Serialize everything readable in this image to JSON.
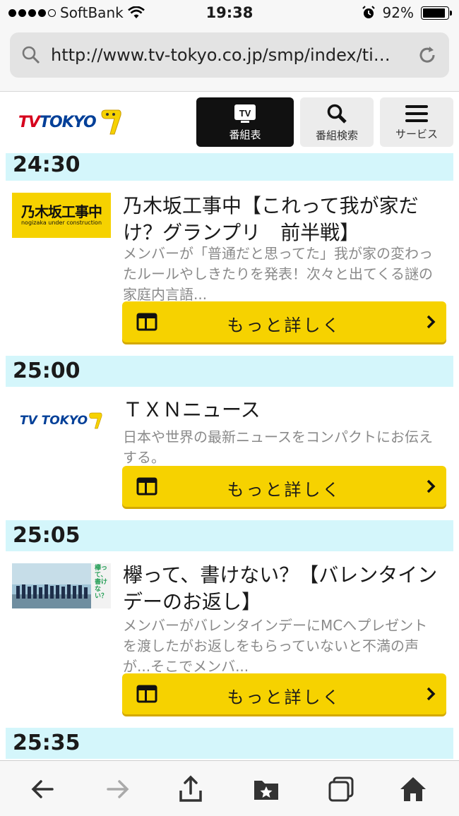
{
  "status_bar": {
    "carrier": "SoftBank",
    "time": "19:38",
    "battery": "92%",
    "battery_level": 0.92
  },
  "browser": {
    "url": "http://www.tv-tokyo.co.jp/smp/index/tim…"
  },
  "site_header": {
    "logo_tv": "TV",
    "logo_tokyo": "TOKYO",
    "nav": [
      {
        "label": "番組表",
        "icon": "tv-icon",
        "active": true
      },
      {
        "label": "番組検索",
        "icon": "search-icon",
        "active": false
      },
      {
        "label": "サービス",
        "icon": "menu-icon",
        "active": false
      }
    ]
  },
  "schedule": [
    {
      "time": "24:30",
      "title": "乃木坂工事中【これって我が家だけ？グランプリ　前半戦】",
      "description": "メンバーが「普通だと思ってた」我が家の変わったルールやしきたりを発表！次々と出てくる謎の家庭内言語...",
      "button": "もっと詳しく",
      "thumb_text": "乃木坂工事中",
      "thumb_sub": "nogizaka under construction"
    },
    {
      "time": "25:00",
      "title": "ＴＸＮニュース",
      "description": "日本や世界の最新ニュースをコンパクトにお伝えする。",
      "button": "もっと詳しく",
      "thumb_text": "TV TOKYO"
    },
    {
      "time": "25:05",
      "title": "欅って、書けない？【バレンタインデーのお返し】",
      "description": "メンバーがバレンタインデーにMCへプレゼントを渡したがお返しをもらっていないと不満の声が...そこでメンバ...",
      "button": "もっと詳しく",
      "thumb_text": "欅って、書けない？"
    },
    {
      "time": "25:35"
    }
  ],
  "colors": {
    "accent": "#f6d200",
    "slot_bg": "#d4f6fb",
    "brand_red": "#d6001c",
    "brand_blue": "#003f98"
  }
}
